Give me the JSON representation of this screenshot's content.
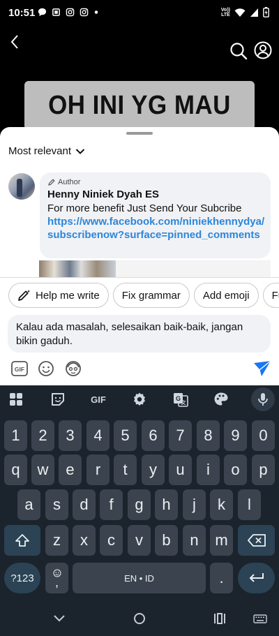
{
  "status_bar": {
    "time": "10:51",
    "left_icons": [
      "chat-bubble-icon",
      "square-icon",
      "instagram-icon",
      "instagram-icon",
      "dot-icon"
    ],
    "volte_label_top": "Vo))",
    "volte_label_bottom": "LTE",
    "right_icons": [
      "wifi-icon",
      "signal-icon",
      "battery-icon"
    ]
  },
  "video": {
    "caption": "OH INI YG MAU"
  },
  "comments_sheet": {
    "sort_label": "Most relevant",
    "comment": {
      "author_badge": "Author",
      "author_name": "Henny Niniek Dyah ES",
      "text": "For more benefit Just Send Your Subcribe",
      "link": "https://www.facebook.com/niniekhennydya/subscribenow?surface=pinned_comments"
    }
  },
  "composer": {
    "chips": [
      {
        "label": "Help me write",
        "icon": "pencil-sparkle-icon"
      },
      {
        "label": "Fix grammar"
      },
      {
        "label": "Add emoji"
      },
      {
        "label": "Fu"
      }
    ],
    "input_value": "Kalau ada masalah, selesaikan baik-baik, jangan bikin gaduh.",
    "tools": [
      "gif-icon",
      "emoji-icon",
      "avatar-sticker-icon",
      "send-icon"
    ],
    "send_color": "#1877f2"
  },
  "keyboard": {
    "toolbar": {
      "gif_label": "GIF"
    },
    "row_numbers": [
      "1",
      "2",
      "3",
      "4",
      "5",
      "6",
      "7",
      "8",
      "9",
      "0"
    ],
    "row_1": [
      "q",
      "w",
      "e",
      "r",
      "t",
      "y",
      "u",
      "i",
      "o",
      "p"
    ],
    "row_2": [
      "a",
      "s",
      "d",
      "f",
      "g",
      "h",
      "j",
      "k",
      "l"
    ],
    "row_3": [
      "z",
      "x",
      "c",
      "v",
      "b",
      "n",
      "m"
    ],
    "symbols_key": "?123",
    "comma_key": ",",
    "space_label": "EN • ID",
    "period_key": "."
  },
  "nav_bar": {
    "icons": [
      "chevron-down-icon",
      "home-circle-icon",
      "recents-icon",
      "keyboard-switch-icon"
    ]
  }
}
